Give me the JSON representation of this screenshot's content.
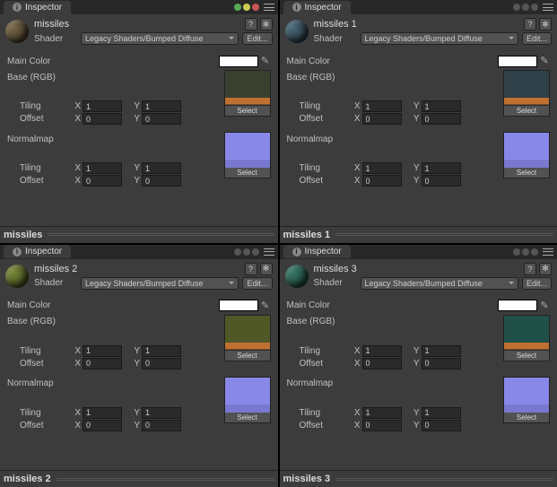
{
  "panels": [
    {
      "tab": "Inspector",
      "material_name": "missiles",
      "shader_label": "Shader",
      "shader_value": "Legacy Shaders/Bumped Diffuse",
      "edit": "Edit...",
      "main_color_label": "Main Color",
      "main_color_value": "#ffffff",
      "base_label": "Base (RGB)",
      "normalmap_label": "Normalmap",
      "tiling_label": "Tiling",
      "offset_label": "Offset",
      "x_label": "X",
      "y_label": "Y",
      "base_tiling_x": "1",
      "base_tiling_y": "1",
      "base_offset_x": "0",
      "base_offset_y": "0",
      "norm_tiling_x": "1",
      "norm_tiling_y": "1",
      "norm_offset_x": "0",
      "norm_offset_y": "0",
      "select": "Select",
      "footer": "missiles",
      "show_traffic": true
    },
    {
      "tab": "Inspector",
      "material_name": "missiles 1",
      "shader_label": "Shader",
      "shader_value": "Legacy Shaders/Bumped Diffuse",
      "edit": "Edit...",
      "main_color_label": "Main Color",
      "main_color_value": "#ffffff",
      "base_label": "Base (RGB)",
      "normalmap_label": "Normalmap",
      "tiling_label": "Tiling",
      "offset_label": "Offset",
      "x_label": "X",
      "y_label": "Y",
      "base_tiling_x": "1",
      "base_tiling_y": "1",
      "base_offset_x": "0",
      "base_offset_y": "0",
      "norm_tiling_x": "1",
      "norm_tiling_y": "1",
      "norm_offset_x": "0",
      "norm_offset_y": "0",
      "select": "Select",
      "footer": "missiles 1",
      "show_traffic": false
    },
    {
      "tab": "Inspector",
      "material_name": "missiles 2",
      "shader_label": "Shader",
      "shader_value": "Legacy Shaders/Bumped Diffuse",
      "edit": "Edit...",
      "main_color_label": "Main Color",
      "main_color_value": "#ffffff",
      "base_label": "Base (RGB)",
      "normalmap_label": "Normalmap",
      "tiling_label": "Tiling",
      "offset_label": "Offset",
      "x_label": "X",
      "y_label": "Y",
      "base_tiling_x": "1",
      "base_tiling_y": "1",
      "base_offset_x": "0",
      "base_offset_y": "0",
      "norm_tiling_x": "1",
      "norm_tiling_y": "1",
      "norm_offset_x": "0",
      "norm_offset_y": "0",
      "select": "Select",
      "footer": "missiles 2",
      "show_traffic": false
    },
    {
      "tab": "Inspector",
      "material_name": "missiles 3",
      "shader_label": "Shader",
      "shader_value": "Legacy Shaders/Bumped Diffuse",
      "edit": "Edit...",
      "main_color_label": "Main Color",
      "main_color_value": "#ffffff",
      "base_label": "Base (RGB)",
      "normalmap_label": "Normalmap",
      "tiling_label": "Tiling",
      "offset_label": "Offset",
      "x_label": "X",
      "y_label": "Y",
      "base_tiling_x": "1",
      "base_tiling_y": "1",
      "base_offset_x": "0",
      "base_offset_y": "0",
      "norm_tiling_x": "1",
      "norm_tiling_y": "1",
      "norm_offset_x": "0",
      "norm_offset_y": "0",
      "select": "Select",
      "footer": "missiles 3",
      "show_traffic": false
    }
  ]
}
